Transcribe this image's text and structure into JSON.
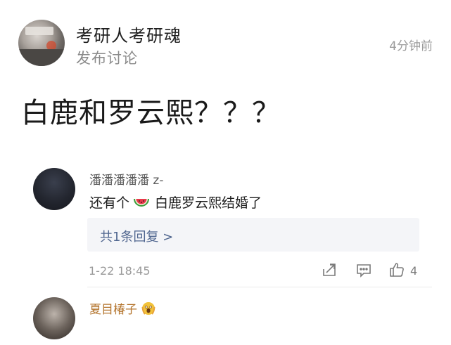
{
  "post": {
    "author_name": "考研人考研魂",
    "subtitle": "发布讨论",
    "time": "4分钟前",
    "body": "白鹿和罗云熙？？？"
  },
  "comment": {
    "username": "潘潘潘潘潘 z-",
    "text_before_icon": "还有个",
    "text_after_icon": "白鹿罗云熙结婚了",
    "emoji_icon": "watermelon-icon",
    "reply_link": "共1条回复 >",
    "date": "1-22 18:45",
    "like_count": "4",
    "action_icons": [
      "share-icon",
      "reply-icon",
      "like-icon"
    ]
  },
  "next_comment": {
    "username": "夏目椿子",
    "emoji_icon": "scream-icon"
  },
  "colors": {
    "reply_link": "#50668f",
    "vip_username": "#b4752e",
    "reply_box_bg": "#f4f5f8"
  }
}
